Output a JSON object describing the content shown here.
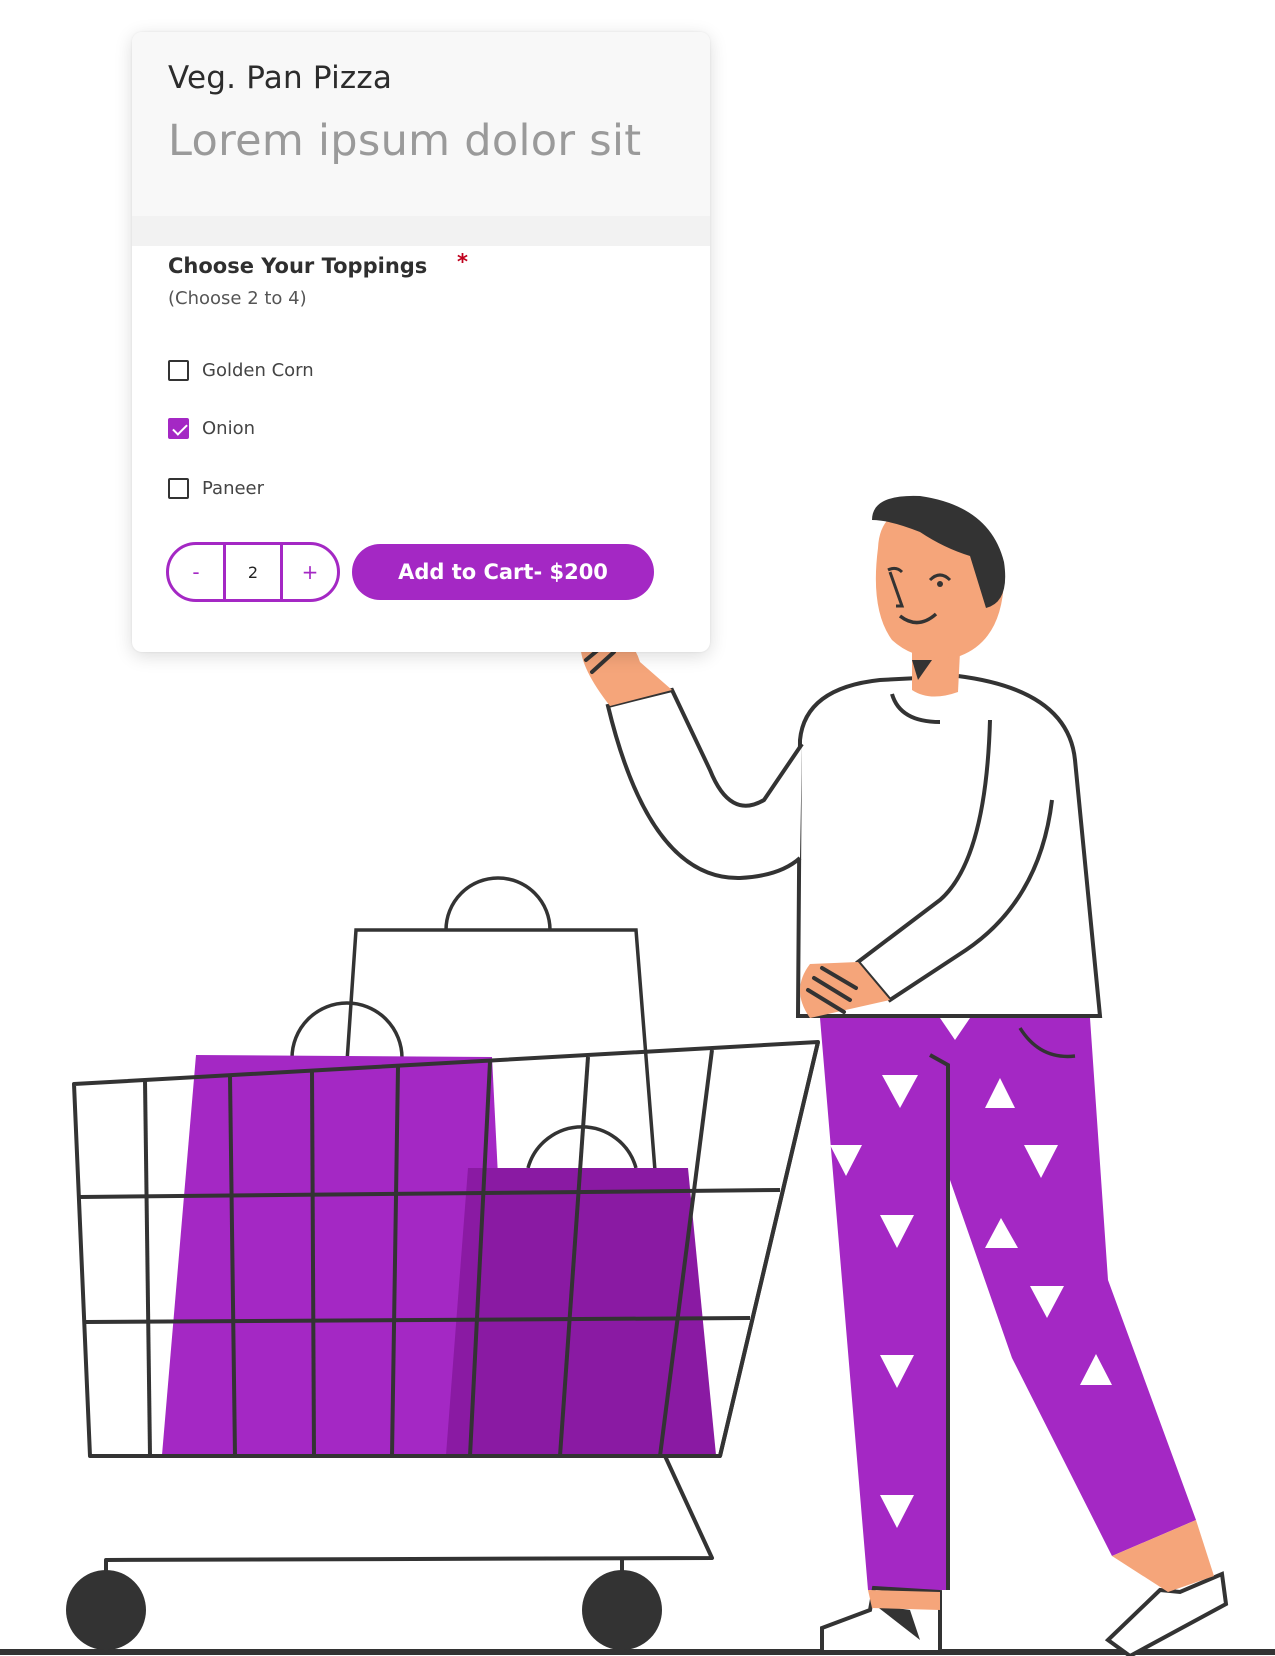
{
  "product": {
    "title": "Veg. Pan Pizza",
    "subtitle": "Lorem ipsum dolor sit"
  },
  "toppings": {
    "heading": "Choose Your Toppings",
    "required_mark": "*",
    "hint": "(Choose 2 to 4)",
    "options": [
      {
        "label": "Golden Corn",
        "checked": false
      },
      {
        "label": "Onion",
        "checked": true
      },
      {
        "label": "Paneer",
        "checked": false
      }
    ]
  },
  "quantity": {
    "decrement": "-",
    "value": "2",
    "increment": "+"
  },
  "cart": {
    "button_label": "Add to Cart- $200"
  },
  "colors": {
    "accent": "#a428c4",
    "accent_dark": "#8a1aa3",
    "skin": "#f5a57a",
    "outline": "#333333"
  }
}
